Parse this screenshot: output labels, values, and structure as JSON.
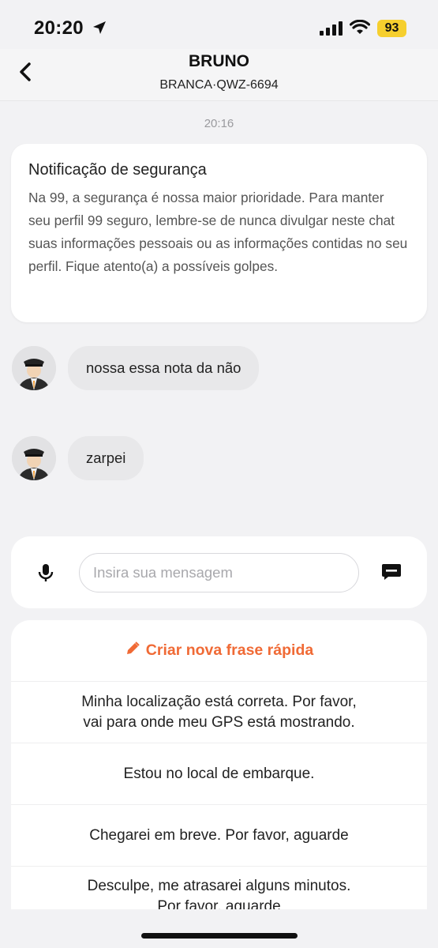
{
  "status_bar": {
    "time": "20:20",
    "battery": "93",
    "icons": [
      "location-arrow-icon",
      "signal-icon",
      "wifi-icon",
      "battery-icon"
    ]
  },
  "header": {
    "driver_name": "BRUNO",
    "car_info": "BRANCA·QWZ-6694",
    "back_icon": "chevron-left-icon"
  },
  "chat": {
    "time": "20:16",
    "safety_notice": {
      "title": "Notificação de segurança",
      "body": "Na 99, a segurança é nossa maior prioridade. Para manter seu perfil 99 seguro, lembre-se de nunca divulgar neste chat suas informações pessoais ou as informações contidas no seu perfil. Fique atento(a) a possíveis golpes."
    },
    "messages": [
      {
        "text": "nossa essa nota da não",
        "avatar_icon": "driver-avatar-icon"
      },
      {
        "text": "zarpei",
        "avatar_icon": "driver-avatar-icon"
      }
    ]
  },
  "composer": {
    "placeholder": "Insira sua mensagem",
    "value": "",
    "mic_icon": "microphone-icon",
    "quick_icon": "quick-message-icon"
  },
  "quick_phrases": {
    "create_label": "Criar nova frase rápida",
    "create_icon": "pencil-icon",
    "accent_color": "#f06a35",
    "items": [
      "Minha localização está correta. Por favor,\nvai para onde meu GPS está mostrando.",
      "Estou no local de embarque.",
      "Chegarei em breve. Por favor, aguarde",
      "Desculpe, me atrasarei alguns minutos.\nPor favor, aguarde"
    ]
  }
}
